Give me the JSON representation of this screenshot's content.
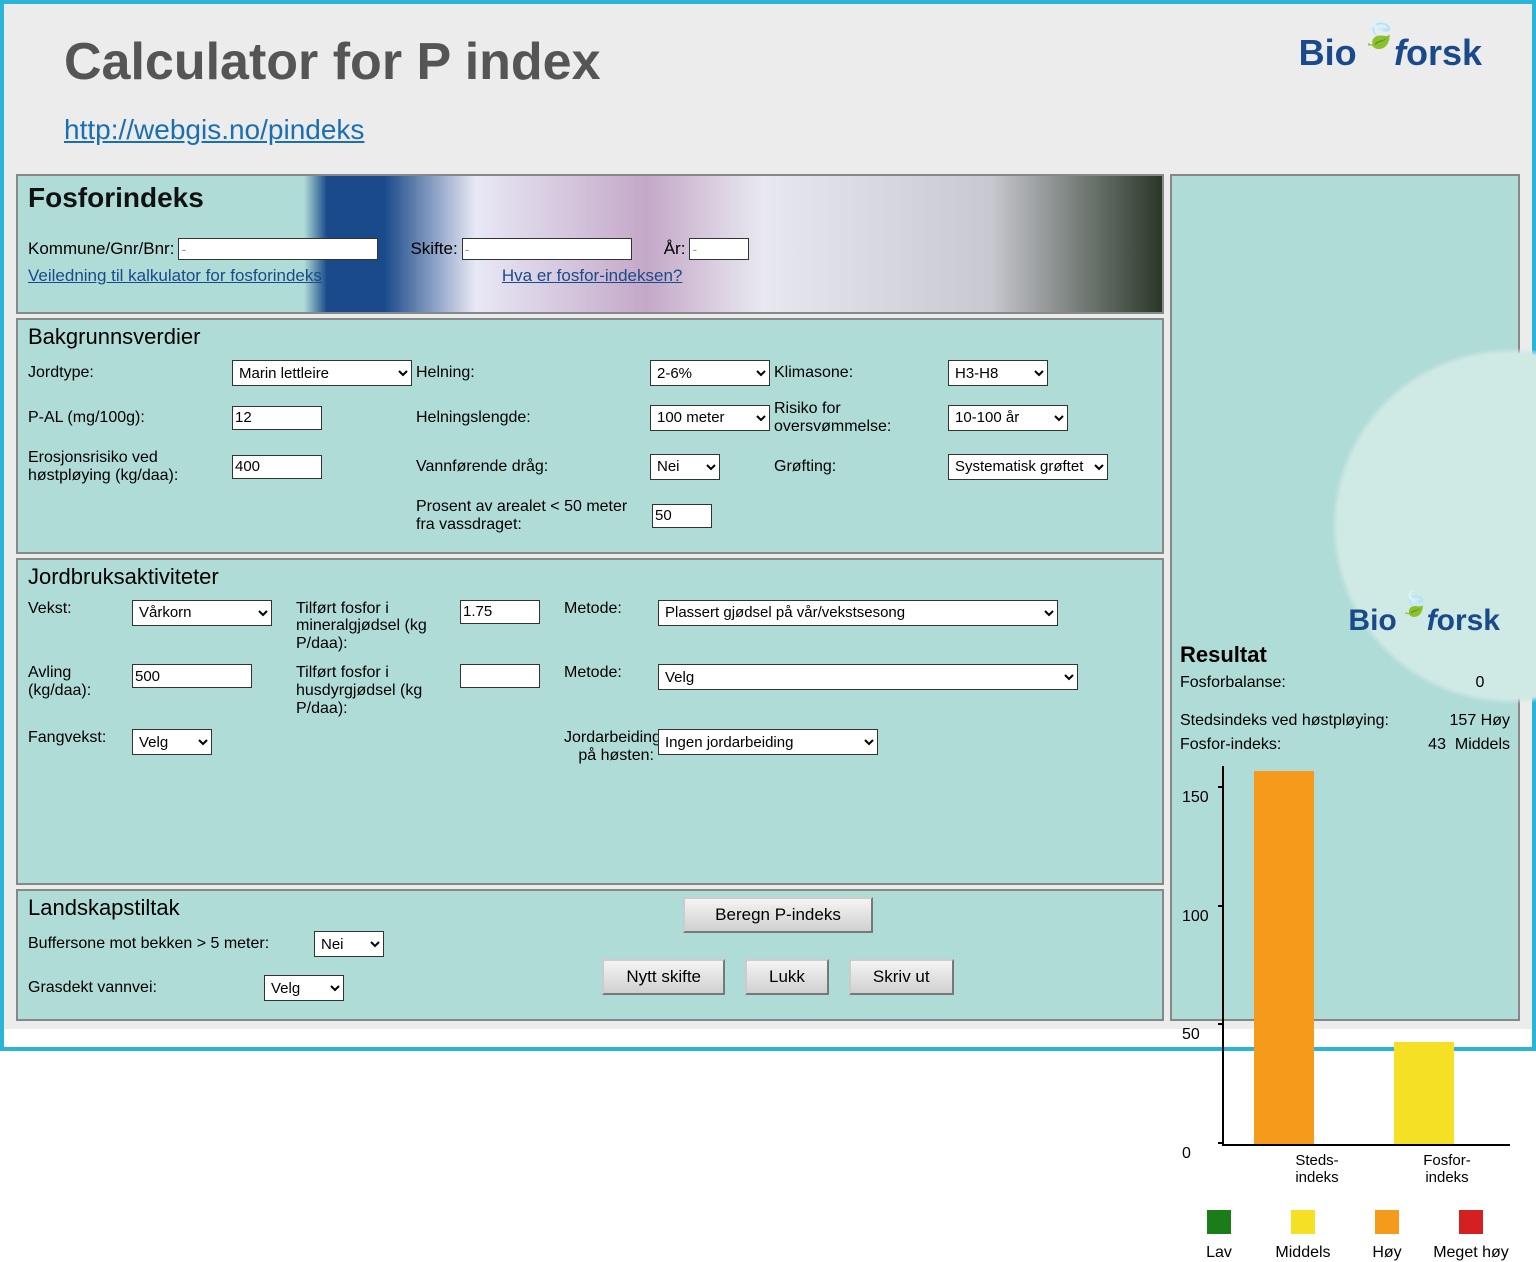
{
  "header": {
    "title": "Calculator for P index",
    "url": "http://webgis.no/pindeks",
    "brand_prefix": "Bio",
    "brand_suffix": "orsk"
  },
  "banner": {
    "app_title": "Fosforindeks",
    "kommune_label": "Kommune/Gnr/Bnr:",
    "kommune_value": "-",
    "skifte_label": "Skifte:",
    "skifte_value": "-",
    "aar_label": "År:",
    "aar_value": "-",
    "guide_link": "Veiledning til kalkulator for fosforindeks",
    "info_link": "Hva er fosfor-indeksen?"
  },
  "bakgrunn": {
    "section_title": "Bakgrunnsverdier",
    "jordtype_label": "Jordtype:",
    "jordtype_value": "Marin lettleire",
    "pal_label": "P-AL (mg/100g):",
    "pal_value": "12",
    "erosjon_label": "Erosjonsrisiko ved høstpløying (kg/daa):",
    "erosjon_value": "400",
    "helning_label": "Helning:",
    "helning_value": "2-6%",
    "helningslengde_label": "Helningslengde:",
    "helningslengde_value": "100 meter",
    "vannforende_label": "Vannførende dråg:",
    "vannforende_value": "Nei",
    "prosent_label": "Prosent av arealet < 50 meter fra vassdraget:",
    "prosent_value": "50",
    "klimasone_label": "Klimasone:",
    "klimasone_value": "H3-H8",
    "risiko_label": "Risiko for oversvømmelse:",
    "risiko_value": "10-100 år",
    "grofting_label": "Grøfting:",
    "grofting_value": "Systematisk grøftet"
  },
  "jordbruk": {
    "section_title": "Jordbruksaktiviteter",
    "vekst_label": "Vekst:",
    "vekst_value": "Vårkorn",
    "avling_label": "Avling (kg/daa):",
    "avling_value": "500",
    "fangvekst_label": "Fangvekst:",
    "fangvekst_value": "Velg",
    "mineral_label": "Tilført fosfor i mineralgjødsel (kg P/daa):",
    "mineral_value": "1.75",
    "husdyr_label": "Tilført fosfor i husdyrgjødsel (kg P/daa):",
    "husdyr_value": "",
    "metode1_label": "Metode:",
    "metode1_value": "Plassert gjødsel på vår/vekstsesong",
    "metode2_label": "Metode:",
    "metode2_value": "Velg",
    "jordarbeid_label": "Jordarbeiding på høsten:",
    "jordarbeid_value": "Ingen jordarbeiding"
  },
  "landskap": {
    "section_title": "Landskapstiltak",
    "buffer_label": "Buffersone mot bekken > 5 meter:",
    "buffer_value": "Nei",
    "grasdekt_label": "Grasdekt vannvei:",
    "grasdekt_value": "Velg",
    "beregn_btn": "Beregn P-indeks",
    "nytt_btn": "Nytt skifte",
    "lukk_btn": "Lukk",
    "skriv_btn": "Skriv ut"
  },
  "result": {
    "title": "Resultat",
    "fosforbalanse_label": "Fosforbalanse:",
    "fosforbalanse_value": "0",
    "stedsindeks_label": "Stedsindeks ved høstpløying:",
    "stedsindeks_value": "157",
    "stedsindeks_cat": "Høy",
    "fosforindeks_label": "Fosfor-indeks:",
    "fosforindeks_value": "43",
    "fosforindeks_cat": "Middels",
    "bar1_label": "Steds-\nindeks",
    "bar2_label": "Fosfor-\nindeks",
    "legend_lav": "Lav",
    "legend_middels": "Middels",
    "legend_hoy": "Høy",
    "legend_meget": "Meget høy"
  },
  "chart_data": {
    "type": "bar",
    "categories": [
      "Steds-indeks",
      "Fosfor-indeks"
    ],
    "values": [
      157,
      43
    ],
    "colors": [
      "#f59a1b",
      "#f5e025"
    ],
    "ylim": [
      0,
      160
    ],
    "ticks": [
      0,
      50,
      100,
      150
    ],
    "ylabel": "",
    "title": "",
    "legend": [
      {
        "label": "Lav",
        "color": "#1a7d1a"
      },
      {
        "label": "Middels",
        "color": "#f5e025"
      },
      {
        "label": "Høy",
        "color": "#f59a1b"
      },
      {
        "label": "Meget høy",
        "color": "#d42020"
      }
    ]
  }
}
